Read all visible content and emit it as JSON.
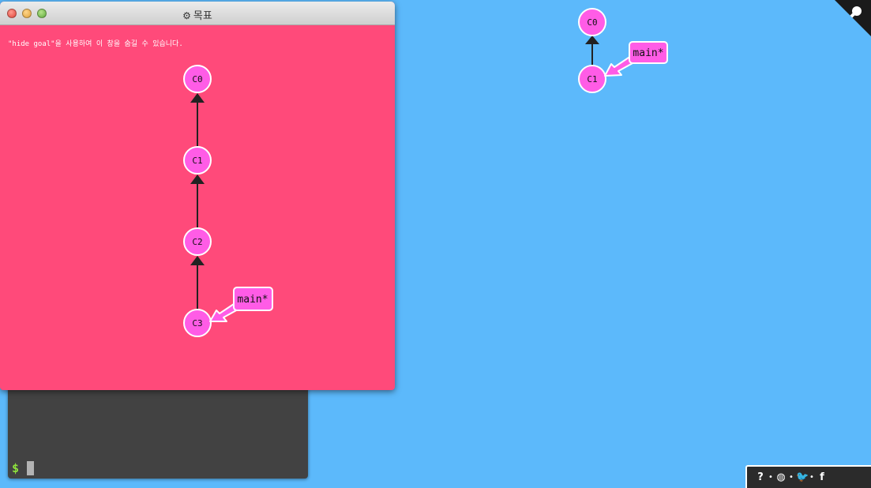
{
  "goal_window": {
    "title": "목표",
    "hint": "\"hide goal\"을 사용하여 이 창을 숨길 수 있습니다.",
    "commits": [
      "C0",
      "C1",
      "C2",
      "C3"
    ],
    "branch_label": "main*"
  },
  "main_view": {
    "commits": [
      "C0",
      "C1"
    ],
    "branch_label": "main*"
  },
  "terminal": {
    "prompt": "$"
  },
  "links": {
    "items": [
      {
        "icon": "help-icon",
        "glyph": "?"
      },
      {
        "icon": "globe-icon",
        "glyph": "◍"
      },
      {
        "icon": "twitter-icon",
        "glyph": "🐦"
      },
      {
        "icon": "facebook-icon",
        "glyph": "f"
      }
    ],
    "separator": "•"
  },
  "colors": {
    "background": "#5cb9fb",
    "goal_background": "#ff4a7a",
    "commit_fill": "#ff5ce6",
    "branch_fill": "#ff5ce6",
    "terminal": "#424242"
  }
}
